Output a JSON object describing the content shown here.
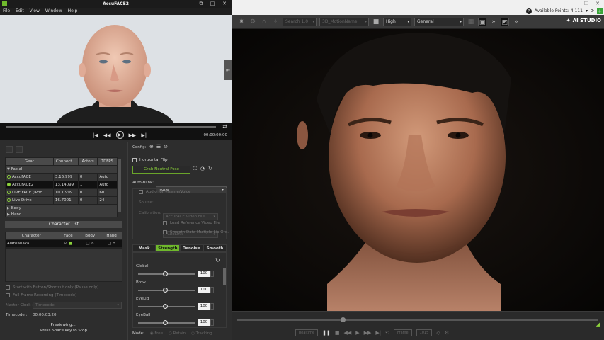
{
  "accuface": {
    "title": "AccuFACE2",
    "menu": [
      "File",
      "Edit",
      "View",
      "Window",
      "Help"
    ],
    "player": {
      "time": "00:00:00:00"
    },
    "gear_table": {
      "headers": [
        "Gear",
        "Connect...",
        "Actors",
        "TCFPS"
      ],
      "group_facial": "Facial",
      "rows": [
        {
          "name": "AccuFACE",
          "connect": "3.16.999",
          "actors": "0",
          "tcfps": "Auto",
          "selected": false,
          "dot_filled": false
        },
        {
          "name": "AccuFACE2",
          "connect": "13.14099",
          "actors": "1",
          "tcfps": "Auto",
          "selected": true,
          "dot_filled": true
        },
        {
          "name": "LIVE FACE (iPho...",
          "connect": "10.1.999",
          "actors": "0",
          "tcfps": "60",
          "selected": false,
          "dot_filled": false
        },
        {
          "name": "Live Drive",
          "connect": "16.7001",
          "actors": "0",
          "tcfps": "24",
          "selected": false,
          "dot_filled": false
        }
      ],
      "group_body": "Body",
      "group_hand": "Hand"
    },
    "character_list": {
      "title": "Character List",
      "headers": [
        "Character",
        "Face",
        "Body",
        "Hand"
      ],
      "rows": [
        {
          "name": "AlanTanaka"
        }
      ]
    },
    "start_with_bb": "Start with Button/Shortcut only (Pause only)",
    "full_frame_recording": "Full Frame Recording (Timecode)",
    "master_clock_label": "Master Clock :",
    "master_clock_value": "Timecode",
    "timecode_label": "Timecode :",
    "timecode_value": "00:00:03:20",
    "status_line1": "Previewing....",
    "status_line2": "Press Space key to Stop",
    "config_label": "Config:",
    "horizontal_flip": "Horizontal Flip",
    "grab_neutral_pose": "Grab Neutral Pose",
    "auto_blink_label": "Auto-Blink:",
    "auto_blink_value": "None",
    "audio_for_visemes": "Audio for Viseme/Voice",
    "source_label": "Source:",
    "source_value": "AccuFACE Video File",
    "calibration_label": "Calibration:",
    "calibration_value": "AutoLink",
    "load_reference": "Load Reference Video File",
    "smooth_lips": "Smooth Data Multiple Lip Ord.",
    "tabs": [
      "Mask",
      "Strength",
      "Denoise",
      "Smooth"
    ],
    "active_tab": "Strength",
    "sliders": [
      {
        "label": "Global",
        "value": "100"
      },
      {
        "label": "Brow",
        "value": "100"
      },
      {
        "label": "EyeLid",
        "value": "100"
      },
      {
        "label": "EyeBall",
        "value": "100"
      }
    ],
    "mode_label": "Mode:",
    "mode_options": [
      "Free",
      "Retain",
      "Tracking"
    ]
  },
  "viewer": {
    "available_points": "Available Points: 4,111",
    "quality": "High",
    "preset": "General",
    "ai_studio": "AI STUDIO",
    "search_label": "Search 1.0",
    "anim_label": "3D_MotionName",
    "timeline_buttons": [
      "Realtime",
      "Frame",
      "1015"
    ]
  }
}
